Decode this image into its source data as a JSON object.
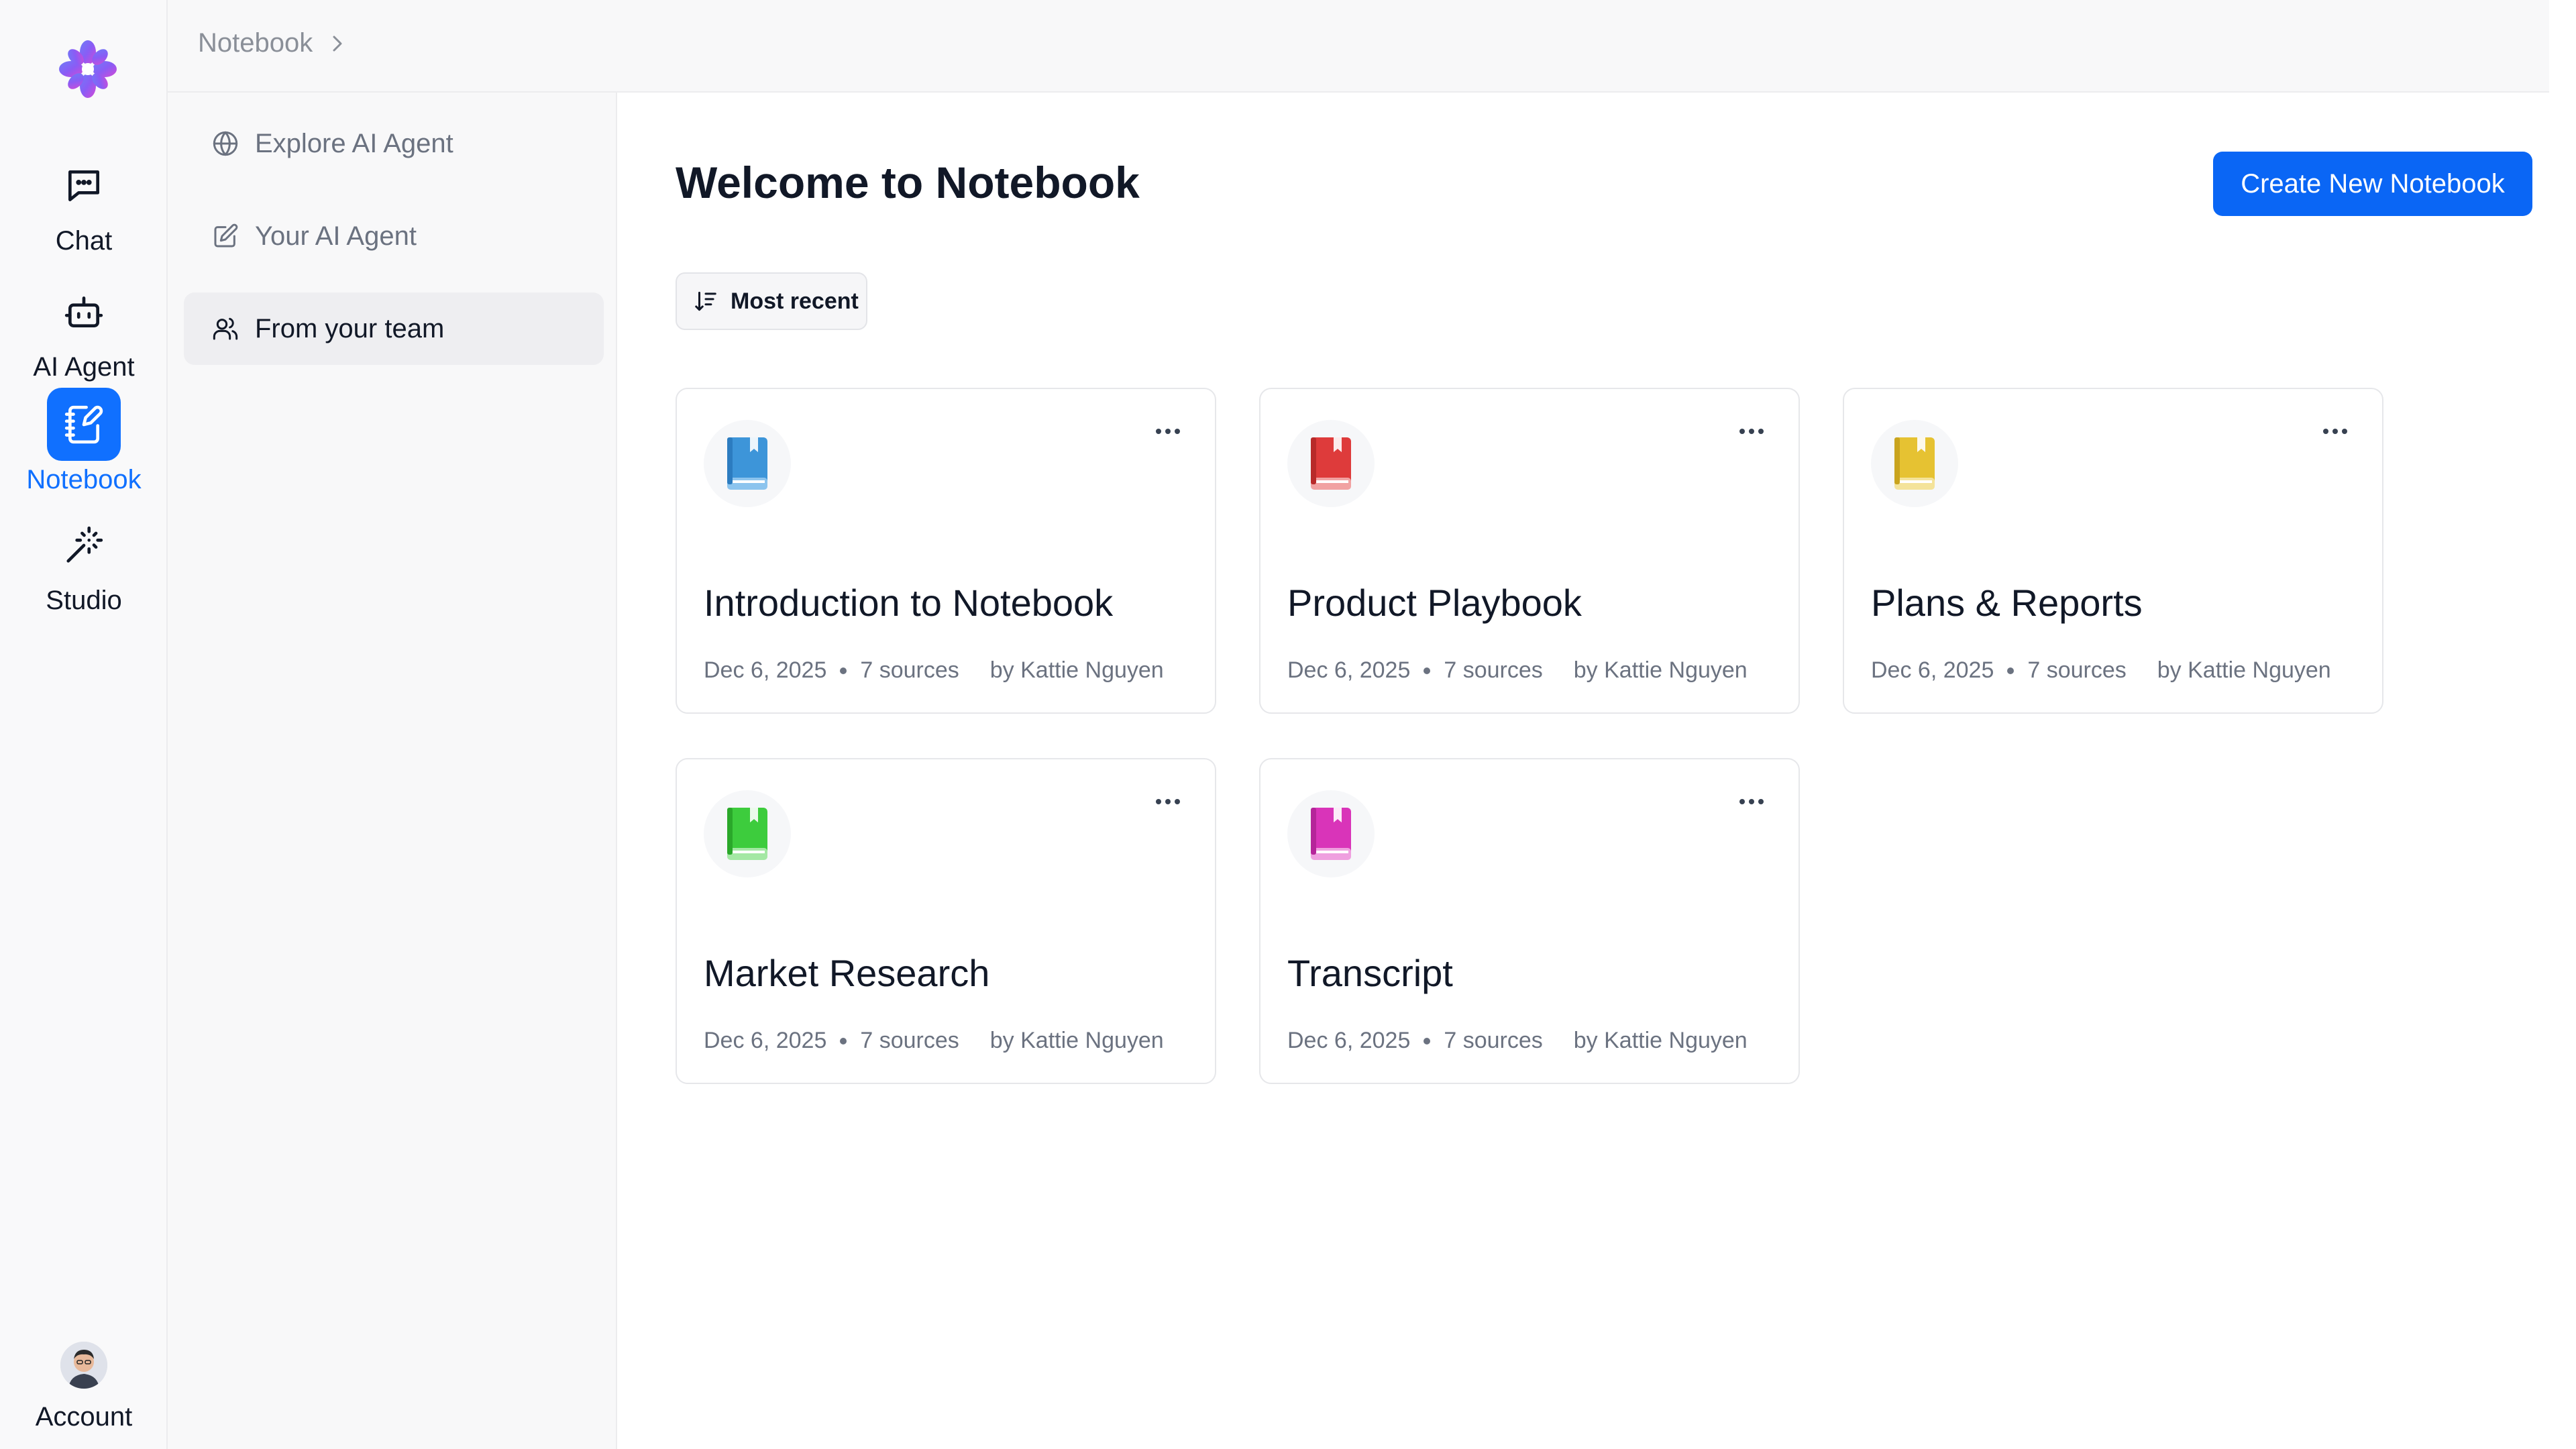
{
  "rail": {
    "items": [
      {
        "label": "Chat",
        "icon": "chat-icon"
      },
      {
        "label": "AI Agent",
        "icon": "robot-icon"
      },
      {
        "label": "Notebook",
        "icon": "notebook-icon",
        "active": true
      },
      {
        "label": "Studio",
        "icon": "magic-wand-icon"
      }
    ],
    "account_label": "Account"
  },
  "breadcrumb": {
    "label": "Notebook"
  },
  "subnav": {
    "items": [
      {
        "label": "Explore AI Agent",
        "icon": "globe-icon"
      },
      {
        "label": "Your AI Agent",
        "icon": "edit-icon"
      },
      {
        "label": "From your team",
        "icon": "users-icon",
        "active": true
      }
    ]
  },
  "main": {
    "title": "Welcome to Notebook",
    "create_button": "Create New Notebook",
    "sort_label": "Most recent"
  },
  "notebooks": [
    {
      "title": "Introduction to Notebook",
      "date": "Dec 6, 2025",
      "sources": "7 sources",
      "author": "by Kattie Nguyen",
      "color": "#3d95d9"
    },
    {
      "title": "Product Playbook",
      "date": "Dec 6, 2025",
      "sources": "7 sources",
      "author": "by Kattie Nguyen",
      "color": "#de3b3b"
    },
    {
      "title": "Plans & Reports",
      "date": "Dec 6, 2025",
      "sources": "7 sources",
      "author": "by Kattie Nguyen",
      "color": "#e6c232"
    },
    {
      "title": "Market Research",
      "date": "Dec 6, 2025",
      "sources": "7 sources",
      "author": "by Kattie Nguyen",
      "color": "#3dcc3d"
    },
    {
      "title": "Transcript",
      "date": "Dec 6, 2025",
      "sources": "7 sources",
      "author": "by Kattie Nguyen",
      "color": "#d934b9"
    }
  ],
  "colors": {
    "accent": "#0a66f5",
    "active_rail": "#1070ff"
  }
}
